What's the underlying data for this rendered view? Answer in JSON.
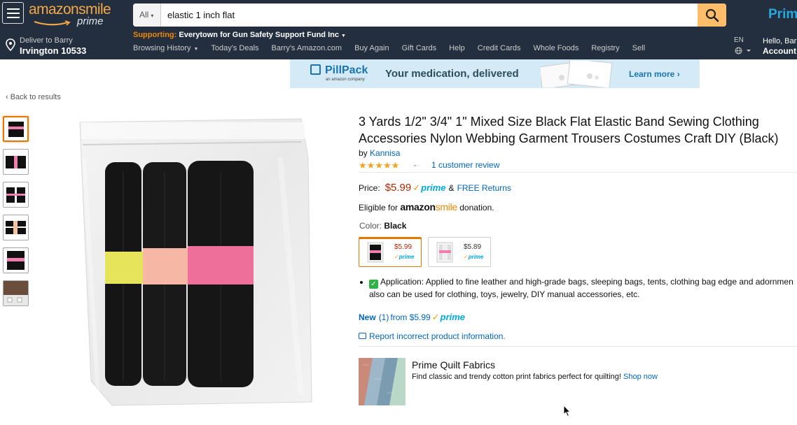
{
  "header": {
    "logo_text": "amazon",
    "logo_text_accent": "smile",
    "logo_sub": "prime",
    "search_category": "All",
    "search_value": "elastic 1 inch flat",
    "prime_link": "Prime",
    "deliver_line1": "Deliver to Barry",
    "deliver_line2": "Irvington 10533",
    "supporting_label": "Supporting:",
    "supporting_org": "Everytown for Gun Safety Support Fund Inc",
    "nav": [
      {
        "label": "Browsing History",
        "caret": true
      },
      {
        "label": "Today's Deals"
      },
      {
        "label": "Barry's Amazon.com"
      },
      {
        "label": "Buy Again"
      },
      {
        "label": "Gift Cards"
      },
      {
        "label": "Help"
      },
      {
        "label": "Credit Cards"
      },
      {
        "label": "Whole Foods"
      },
      {
        "label": "Registry"
      },
      {
        "label": "Sell"
      }
    ],
    "language": "EN",
    "hello": "Hello, Bar",
    "account": "Account"
  },
  "banner": {
    "brand": "PillPack",
    "brand_sub": "an amazon company",
    "tagline": "Your medication, delivered",
    "cta": "Learn more ›"
  },
  "back_link": "‹ Back to results",
  "product": {
    "title_line1": "3 Yards 1/2\" 3/4\" 1\" Mixed Size Black Flat Elastic Band Sewing Clothing",
    "title_line2": "Accessories Nylon Webbing Garment Trousers Costumes Craft DIY (Black)",
    "by_label": "by",
    "brand": "Kannisa",
    "rating": 5,
    "review_count_text": "1 customer review",
    "price_label": "Price:",
    "price": "$5.99",
    "prime_word": "prime",
    "and_text": "&",
    "free_returns": "FREE Returns",
    "eligible_prefix": "Eligible for",
    "eligible_brand": "amazon",
    "eligible_brand_accent": "smile",
    "eligible_suffix": "donation.",
    "color_label": "Color:",
    "color_value": "Black",
    "swatches": [
      {
        "price": "$5.99",
        "prime": "prime",
        "selected": true,
        "price_color": "#b12704"
      },
      {
        "price": "$5.89",
        "prime": "prime",
        "selected": false,
        "price_color": "#333333"
      }
    ],
    "bullet": "Application: Applied to fine leather and high-grade bags, sleeping bags, tents, clothing bag edge and adornmen",
    "bullet_line2": "also can be used for clothing, toys, jewelry, DIY manual accessories, etc.",
    "new_label": "New",
    "new_count": "(1)",
    "new_from": "from $5.99",
    "report_link": "Report incorrect product information."
  },
  "ad": {
    "title": "Prime Quilt Fabrics",
    "desc": "Find classic and trendy cotton print fabrics perfect for quilting!",
    "cta": "Shop now"
  },
  "colors": {
    "header_bg": "#232f3e",
    "search_button": "#febd69",
    "link": "#0066c0",
    "price": "#b12704",
    "prime": "#00a8e1",
    "selected_border": "#e77600"
  }
}
